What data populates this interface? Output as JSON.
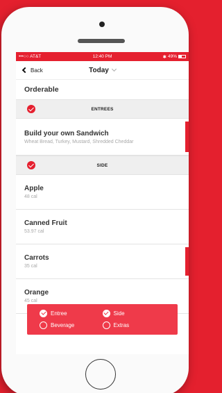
{
  "status": {
    "carrier": "•••○○ AT&T",
    "time": "12:40 PM",
    "battery": "49%"
  },
  "nav": {
    "back_label": "Back",
    "title": "Today"
  },
  "orderable_label": "Orderable",
  "sections": {
    "entrees": "ENTREES",
    "side": "SIDE"
  },
  "items": [
    {
      "name": "Build your own Sandwich",
      "detail": "Wheat Bread, Turkey, Mustard, Shredded Cheddar"
    },
    {
      "name": "Apple",
      "detail": "48 cal"
    },
    {
      "name": "Canned Fruit",
      "detail": "53.97 cal"
    },
    {
      "name": "Carrots",
      "detail": "35 cal"
    },
    {
      "name": "Orange",
      "detail": "45 cal"
    }
  ],
  "filters": [
    {
      "label": "Entree",
      "selected": true
    },
    {
      "label": "Side",
      "selected": true
    },
    {
      "label": "Beverage",
      "selected": false
    },
    {
      "label": "Extras",
      "selected": false
    }
  ],
  "colors": {
    "accent": "#e5202f",
    "background": "#e4202e",
    "filter_panel": "#ef3a4a"
  },
  "icons": [
    "signal-icon",
    "wifi-icon",
    "bluetooth-icon",
    "battery-icon",
    "back-chevron-icon",
    "dropdown-chevron-icon",
    "check-icon",
    "radio-icon"
  ]
}
